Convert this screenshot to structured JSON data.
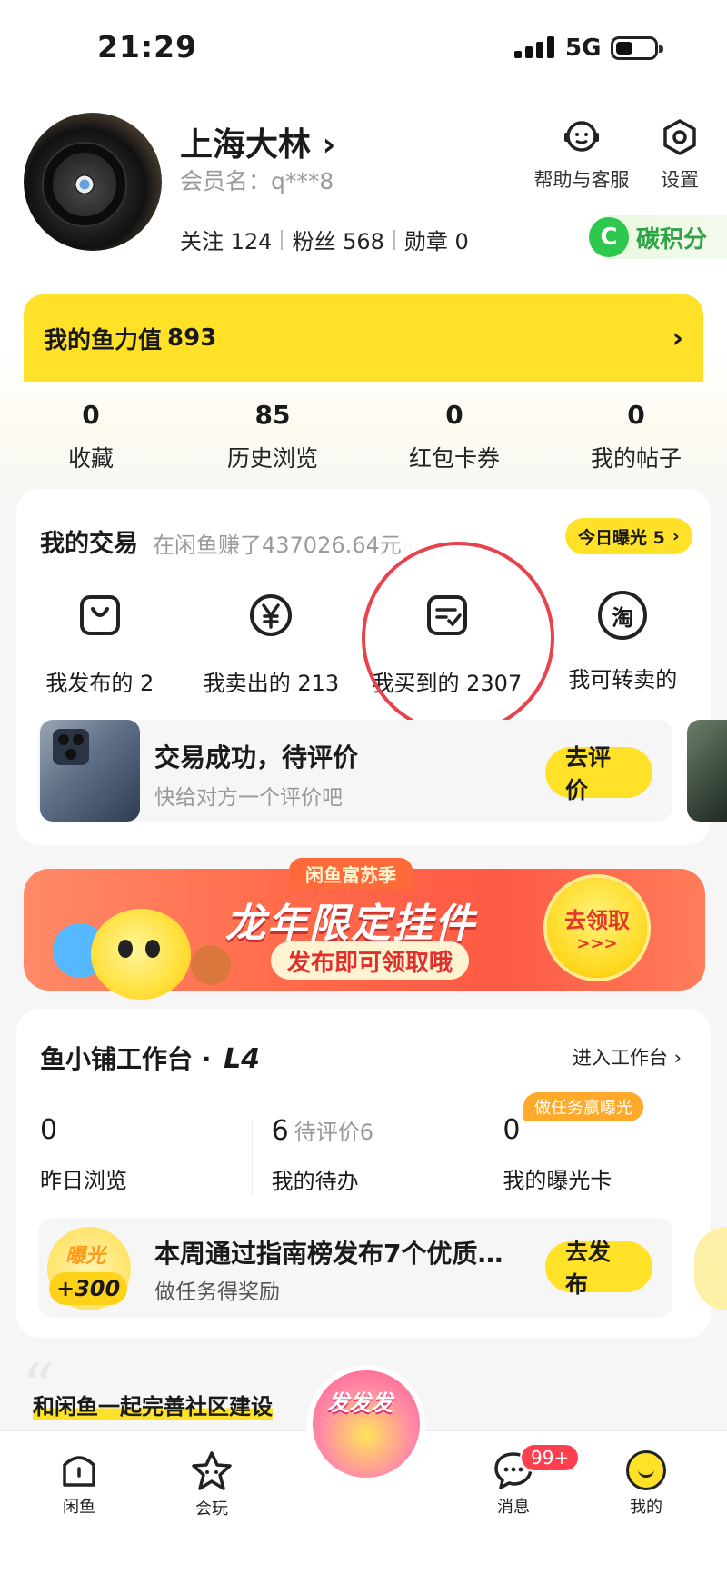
{
  "status_bar": {
    "time": "21:29",
    "network": "5G"
  },
  "profile": {
    "name": "上海大林",
    "member_label": "会员名：q***8",
    "follow_label": "关注",
    "follow_count": "124",
    "fans_label": "粉丝",
    "fans_count": "568",
    "medal_label": "勋章",
    "medal_count": "0",
    "help_label": "帮助与客服",
    "settings_label": "设置",
    "carbon_icon": "C",
    "carbon_label": "碳积分"
  },
  "fish_power": {
    "label": "我的鱼力值",
    "value": "893"
  },
  "counts": [
    {
      "value": "0",
      "label": "收藏"
    },
    {
      "value": "85",
      "label": "历史浏览"
    },
    {
      "value": "0",
      "label": "红包卡券"
    },
    {
      "value": "0",
      "label": "我的帖子"
    }
  ],
  "trade": {
    "title": "我的交易",
    "subtitle": "在闲鱼赚了437026.64元",
    "expose_label": "今日曝光 5",
    "items": [
      {
        "label": "我发布的 2",
        "icon": "bag-icon"
      },
      {
        "label": "我卖出的 213",
        "icon": "yen-icon"
      },
      {
        "label": "我买到的 2307",
        "icon": "receipt-check-icon"
      },
      {
        "label": "我可转卖的",
        "icon": "taobao-icon",
        "glyph": "淘"
      }
    ],
    "eval_title": "交易成功，待评价",
    "eval_sub": "快给对方一个评价吧",
    "eval_button": "去评价"
  },
  "promo": {
    "tag": "闲鱼富苏季",
    "title": "龙年限定挂件",
    "subtitle": "发布即可领取哦",
    "button": "去领取",
    "button_arrows": ">>>"
  },
  "shop": {
    "title": "鱼小铺工作台 · ",
    "level": "L4",
    "enter_label": "进入工作台",
    "task_tag": "做任务赢曝光",
    "stats": [
      {
        "value": "0",
        "extra": "",
        "label": "昨日浏览"
      },
      {
        "value": "6",
        "extra": "待评价6",
        "label": "我的待办"
      },
      {
        "value": "0",
        "extra": "",
        "label": "我的曝光卡"
      }
    ],
    "badge_top": "曝光",
    "badge_bottom": "+300",
    "task_title": "本周通过指南榜发布7个优质…",
    "task_sub": "做任务得奖励",
    "task_button": "去发布"
  },
  "community": {
    "title": "和闲鱼一起完善社区建设"
  },
  "tabbar": {
    "home": "闲鱼",
    "play": "会玩",
    "center": "发发发",
    "messages": "消息",
    "messages_badge": "99+",
    "mine": "我的"
  }
}
